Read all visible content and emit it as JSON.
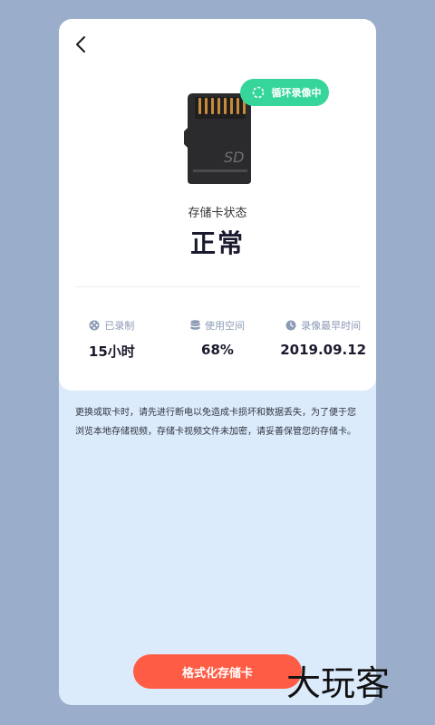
{
  "header": {
    "back_icon": "chevron-left-icon"
  },
  "sd_card": {
    "label": "SD",
    "icon": "sd-card-icon"
  },
  "badge": {
    "label": "循环录像中",
    "icon": "loop-icon",
    "color": "#36d69b"
  },
  "status": {
    "label": "存储卡状态",
    "value": "正常"
  },
  "stats": [
    {
      "label": "已录制",
      "value": "15小时",
      "icon": "film-reel-icon"
    },
    {
      "label": "使用空间",
      "value": "68%",
      "icon": "database-icon"
    },
    {
      "label": "录像最早时间",
      "value": "2019.09.12",
      "icon": "clock-icon"
    }
  ],
  "notice": {
    "text": "更换或取卡时，请先进行断电以免造成卡损坏和数据丢失，为了便于您浏览本地存储视频，存储卡视频文件未加密，请妥善保管您的存储卡。"
  },
  "format_button": {
    "label": "格式化存储卡",
    "color": "#ff5c45"
  },
  "watermark": {
    "text": "大玩客"
  }
}
